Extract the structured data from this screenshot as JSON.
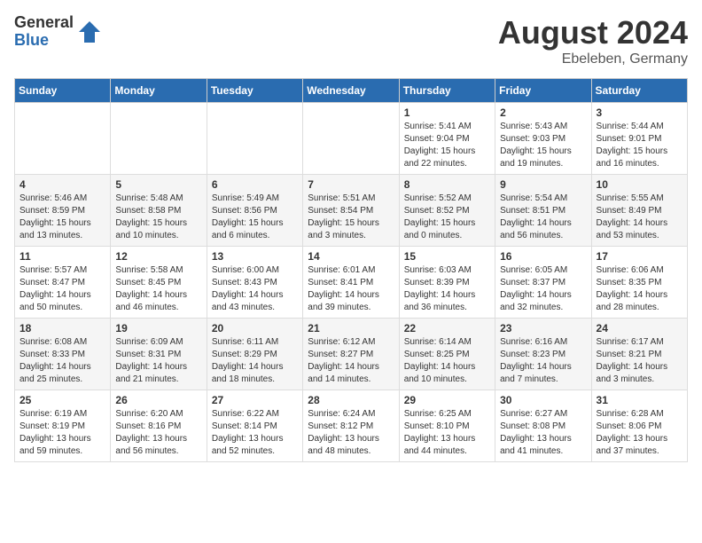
{
  "logo": {
    "general": "General",
    "blue": "Blue"
  },
  "title": {
    "month_year": "August 2024",
    "location": "Ebeleben, Germany"
  },
  "days_of_week": [
    "Sunday",
    "Monday",
    "Tuesday",
    "Wednesday",
    "Thursday",
    "Friday",
    "Saturday"
  ],
  "weeks": [
    [
      {
        "day": "",
        "info": ""
      },
      {
        "day": "",
        "info": ""
      },
      {
        "day": "",
        "info": ""
      },
      {
        "day": "",
        "info": ""
      },
      {
        "day": "1",
        "info": "Sunrise: 5:41 AM\nSunset: 9:04 PM\nDaylight: 15 hours and 22 minutes."
      },
      {
        "day": "2",
        "info": "Sunrise: 5:43 AM\nSunset: 9:03 PM\nDaylight: 15 hours and 19 minutes."
      },
      {
        "day": "3",
        "info": "Sunrise: 5:44 AM\nSunset: 9:01 PM\nDaylight: 15 hours and 16 minutes."
      }
    ],
    [
      {
        "day": "4",
        "info": "Sunrise: 5:46 AM\nSunset: 8:59 PM\nDaylight: 15 hours and 13 minutes."
      },
      {
        "day": "5",
        "info": "Sunrise: 5:48 AM\nSunset: 8:58 PM\nDaylight: 15 hours and 10 minutes."
      },
      {
        "day": "6",
        "info": "Sunrise: 5:49 AM\nSunset: 8:56 PM\nDaylight: 15 hours and 6 minutes."
      },
      {
        "day": "7",
        "info": "Sunrise: 5:51 AM\nSunset: 8:54 PM\nDaylight: 15 hours and 3 minutes."
      },
      {
        "day": "8",
        "info": "Sunrise: 5:52 AM\nSunset: 8:52 PM\nDaylight: 15 hours and 0 minutes."
      },
      {
        "day": "9",
        "info": "Sunrise: 5:54 AM\nSunset: 8:51 PM\nDaylight: 14 hours and 56 minutes."
      },
      {
        "day": "10",
        "info": "Sunrise: 5:55 AM\nSunset: 8:49 PM\nDaylight: 14 hours and 53 minutes."
      }
    ],
    [
      {
        "day": "11",
        "info": "Sunrise: 5:57 AM\nSunset: 8:47 PM\nDaylight: 14 hours and 50 minutes."
      },
      {
        "day": "12",
        "info": "Sunrise: 5:58 AM\nSunset: 8:45 PM\nDaylight: 14 hours and 46 minutes."
      },
      {
        "day": "13",
        "info": "Sunrise: 6:00 AM\nSunset: 8:43 PM\nDaylight: 14 hours and 43 minutes."
      },
      {
        "day": "14",
        "info": "Sunrise: 6:01 AM\nSunset: 8:41 PM\nDaylight: 14 hours and 39 minutes."
      },
      {
        "day": "15",
        "info": "Sunrise: 6:03 AM\nSunset: 8:39 PM\nDaylight: 14 hours and 36 minutes."
      },
      {
        "day": "16",
        "info": "Sunrise: 6:05 AM\nSunset: 8:37 PM\nDaylight: 14 hours and 32 minutes."
      },
      {
        "day": "17",
        "info": "Sunrise: 6:06 AM\nSunset: 8:35 PM\nDaylight: 14 hours and 28 minutes."
      }
    ],
    [
      {
        "day": "18",
        "info": "Sunrise: 6:08 AM\nSunset: 8:33 PM\nDaylight: 14 hours and 25 minutes."
      },
      {
        "day": "19",
        "info": "Sunrise: 6:09 AM\nSunset: 8:31 PM\nDaylight: 14 hours and 21 minutes."
      },
      {
        "day": "20",
        "info": "Sunrise: 6:11 AM\nSunset: 8:29 PM\nDaylight: 14 hours and 18 minutes."
      },
      {
        "day": "21",
        "info": "Sunrise: 6:12 AM\nSunset: 8:27 PM\nDaylight: 14 hours and 14 minutes."
      },
      {
        "day": "22",
        "info": "Sunrise: 6:14 AM\nSunset: 8:25 PM\nDaylight: 14 hours and 10 minutes."
      },
      {
        "day": "23",
        "info": "Sunrise: 6:16 AM\nSunset: 8:23 PM\nDaylight: 14 hours and 7 minutes."
      },
      {
        "day": "24",
        "info": "Sunrise: 6:17 AM\nSunset: 8:21 PM\nDaylight: 14 hours and 3 minutes."
      }
    ],
    [
      {
        "day": "25",
        "info": "Sunrise: 6:19 AM\nSunset: 8:19 PM\nDaylight: 13 hours and 59 minutes."
      },
      {
        "day": "26",
        "info": "Sunrise: 6:20 AM\nSunset: 8:16 PM\nDaylight: 13 hours and 56 minutes."
      },
      {
        "day": "27",
        "info": "Sunrise: 6:22 AM\nSunset: 8:14 PM\nDaylight: 13 hours and 52 minutes."
      },
      {
        "day": "28",
        "info": "Sunrise: 6:24 AM\nSunset: 8:12 PM\nDaylight: 13 hours and 48 minutes."
      },
      {
        "day": "29",
        "info": "Sunrise: 6:25 AM\nSunset: 8:10 PM\nDaylight: 13 hours and 44 minutes."
      },
      {
        "day": "30",
        "info": "Sunrise: 6:27 AM\nSunset: 8:08 PM\nDaylight: 13 hours and 41 minutes."
      },
      {
        "day": "31",
        "info": "Sunrise: 6:28 AM\nSunset: 8:06 PM\nDaylight: 13 hours and 37 minutes."
      }
    ]
  ]
}
